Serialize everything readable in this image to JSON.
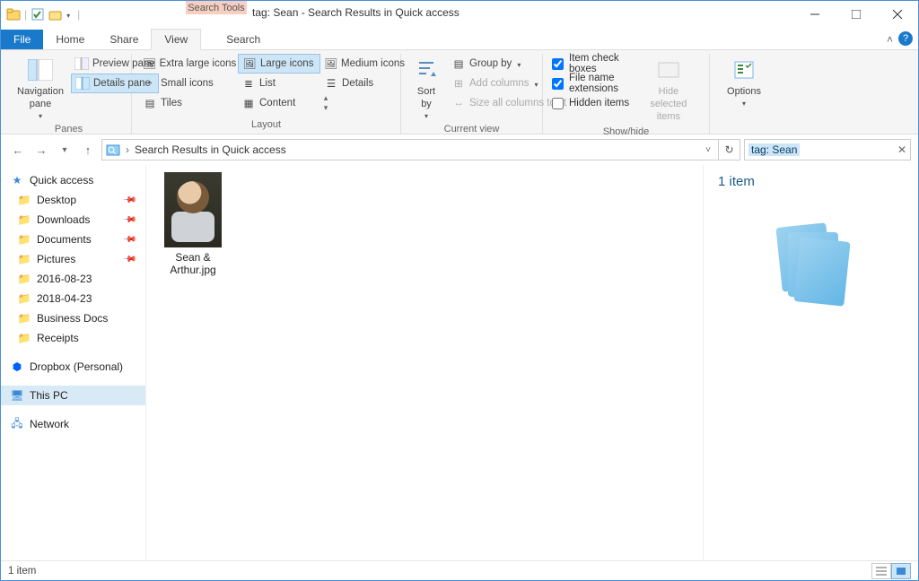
{
  "window": {
    "contextual_tab": "Search Tools",
    "title": "tag: Sean - Search Results in Quick access"
  },
  "tabs": {
    "file": "File",
    "home": "Home",
    "share": "Share",
    "view": "View",
    "search": "Search"
  },
  "ribbon": {
    "panes": {
      "navigation": "Navigation pane",
      "preview": "Preview pane",
      "details": "Details pane",
      "group_label": "Panes"
    },
    "layout": {
      "extra_large": "Extra large icons",
      "large": "Large icons",
      "medium": "Medium icons",
      "small": "Small icons",
      "list": "List",
      "details": "Details",
      "tiles": "Tiles",
      "content": "Content",
      "group_label": "Layout"
    },
    "current_view": {
      "sort_by": "Sort by",
      "group_by": "Group by",
      "add_columns": "Add columns",
      "size_all": "Size all columns to fit",
      "group_label": "Current view"
    },
    "show_hide": {
      "item_check": "Item check boxes",
      "file_ext": "File name extensions",
      "hidden": "Hidden items",
      "hide_selected": "Hide selected items",
      "group_label": "Show/hide"
    },
    "options": {
      "label": "Options"
    }
  },
  "addressbar": {
    "crumb": "Search Results in Quick access"
  },
  "searchbox": {
    "value": "tag: Sean"
  },
  "sidebar": {
    "quick_access": "Quick access",
    "items": [
      {
        "label": "Desktop",
        "pinned": true
      },
      {
        "label": "Downloads",
        "pinned": true
      },
      {
        "label": "Documents",
        "pinned": true
      },
      {
        "label": "Pictures",
        "pinned": true
      },
      {
        "label": "2016-08-23",
        "pinned": false
      },
      {
        "label": "2018-04-23",
        "pinned": false
      },
      {
        "label": "Business Docs",
        "pinned": false
      },
      {
        "label": "Receipts",
        "pinned": false
      }
    ],
    "dropbox": "Dropbox (Personal)",
    "this_pc": "This PC",
    "network": "Network"
  },
  "results": {
    "file_name": "Sean & Arthur.jpg"
  },
  "details": {
    "count": "1 item"
  },
  "statusbar": {
    "text": "1 item"
  }
}
